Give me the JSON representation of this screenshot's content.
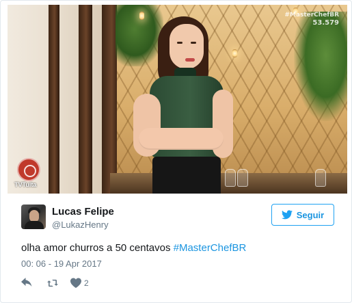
{
  "media": {
    "watermark_hashtag": "#MasterChefBR",
    "watermark_count": "53.579",
    "channel_logo_text": "TVTuíta"
  },
  "tweet": {
    "author": {
      "display_name": "Lucas Felipe",
      "handle": "@LukazHenry"
    },
    "follow_button": {
      "label": "Seguir",
      "icon": "twitter-bird-icon"
    },
    "text": "olha amor churros a 50 centavos",
    "hashtag": "#MasterChefBR",
    "timestamp": "00: 06 - 19 Apr 2017",
    "actions": {
      "reply_icon": "reply-icon",
      "retweet_icon": "retweet-icon",
      "like_icon": "heart-icon",
      "like_count": "2"
    }
  },
  "colors": {
    "accent": "#1b95e0",
    "muted_text": "#657786",
    "primary_text": "#14171a",
    "border": "#e1e8ed"
  }
}
